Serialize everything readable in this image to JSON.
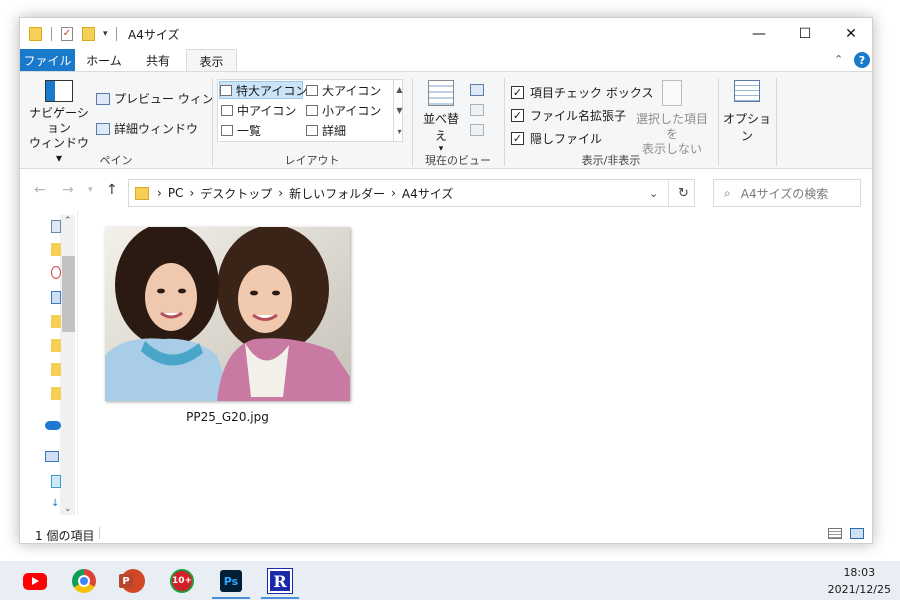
{
  "window": {
    "title": "A4サイズ",
    "controls": {
      "minimize": "—",
      "maximize": "☐",
      "close": "✕"
    }
  },
  "ribbon_tabs": [
    "ファイル",
    "ホーム",
    "共有",
    "表示"
  ],
  "ribbon": {
    "pane_group": {
      "nav_pane_line1": "ナビゲーション",
      "nav_pane_line2": "ウィンドウ",
      "preview_pane": "プレビュー ウィンドウ",
      "details_pane": "詳細ウィンドウ",
      "label": "ペイン"
    },
    "layout_group": {
      "options": [
        "特大アイコン",
        "大アイコン",
        "中アイコン",
        "小アイコン",
        "一覧",
        "詳細"
      ],
      "selected": "特大アイコン",
      "label": "レイアウト"
    },
    "current_view_group": {
      "sort_label": "並べ替え",
      "label": "現在のビュー"
    },
    "show_hide_group": {
      "checkboxes": [
        {
          "label": "項目チェック ボックス",
          "checked": true
        },
        {
          "label": "ファイル名拡張子",
          "checked": true
        },
        {
          "label": "隠しファイル",
          "checked": true
        }
      ],
      "hide_selected_line1": "選択した項目を",
      "hide_selected_line2": "表示しない",
      "label": "表示/非表示"
    },
    "options_label": "オプション"
  },
  "address_bar": {
    "crumbs": [
      "PC",
      "デスクトップ",
      "新しいフォルダー",
      "A4サイズ"
    ],
    "separator": "›",
    "search_placeholder": "A4サイズの検索"
  },
  "files": [
    {
      "name": "PP25_G20.jpg"
    }
  ],
  "status_bar": {
    "item_count": "1 個の項目"
  },
  "taskbar": {
    "apps": [
      "youtube-icon",
      "chrome-icon",
      "powerpoint-icon",
      "app-10plus-icon",
      "photoshop-icon",
      "r-app-icon"
    ],
    "ps_label": "Ps",
    "ppt_label": "P",
    "tenplus_label": "10+",
    "r_label": "R",
    "time": "18:03",
    "date": "2021/12/25"
  },
  "colors": {
    "accent": "#1979ca",
    "ribbon_bg": "#f5f6f7",
    "selection": "#cce4f7",
    "folder_yellow": "#f6cf57",
    "taskbar_bg": "#e9eef4"
  }
}
